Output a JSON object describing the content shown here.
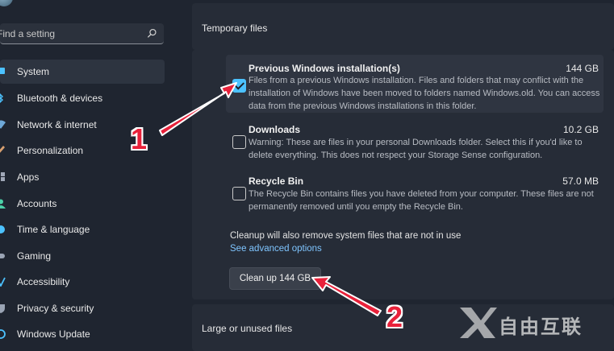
{
  "sidebar": {
    "search_placeholder": "Find a setting",
    "items": [
      {
        "label": "System",
        "icon": "system-icon",
        "selected": true
      },
      {
        "label": "Bluetooth & devices",
        "icon": "bluetooth-icon"
      },
      {
        "label": "Network & internet",
        "icon": "wifi-icon"
      },
      {
        "label": "Personalization",
        "icon": "brush-icon"
      },
      {
        "label": "Apps",
        "icon": "apps-icon"
      },
      {
        "label": "Accounts",
        "icon": "person-icon"
      },
      {
        "label": "Time & language",
        "icon": "globe-clock-icon"
      },
      {
        "label": "Gaming",
        "icon": "gamepad-icon"
      },
      {
        "label": "Accessibility",
        "icon": "accessibility-icon"
      },
      {
        "label": "Privacy & security",
        "icon": "shield-icon"
      },
      {
        "label": "Windows Update",
        "icon": "update-icon"
      }
    ]
  },
  "main": {
    "section_title": "Temporary files",
    "files": [
      {
        "title": "Previous Windows installation(s)",
        "size": "144 GB",
        "checked": true,
        "description": "Files from a previous Windows installation.  Files and folders that may conflict with the installation of Windows have been moved to folders named Windows.old.  You can access data from the previous Windows installations in this folder."
      },
      {
        "title": "Downloads",
        "size": "10.2 GB",
        "checked": false,
        "description": "Warning: These are files in your personal Downloads folder. Select this if you'd like to delete everything. This does not respect your Storage Sense configuration."
      },
      {
        "title": "Recycle Bin",
        "size": "57.0 MB",
        "checked": false,
        "description": "The Recycle Bin contains files you have deleted from your computer. These files are not permanently removed until you empty the Recycle Bin."
      }
    ],
    "cleanup_note": "Cleanup will also remove system files that are not in use",
    "advanced_link": "See advanced options",
    "cleanup_button": "Clean up 144 GB",
    "next_section_title": "Large or unused files"
  },
  "annotations": {
    "step1": "1",
    "step2": "2",
    "arrow_color": "#e8213a"
  },
  "watermark": {
    "text": "自由互联",
    "logo": "x-logo-icon"
  },
  "colors": {
    "background": "#1f2530",
    "panel": "#262c37",
    "accent": "#4cc2ff",
    "link": "#7fc5ff"
  }
}
